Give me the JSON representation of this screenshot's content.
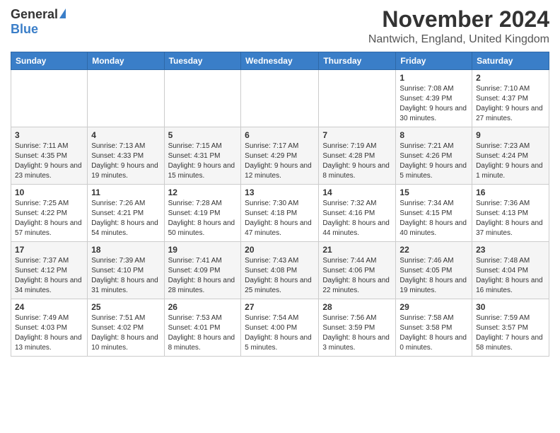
{
  "header": {
    "logo_general": "General",
    "logo_blue": "Blue",
    "month_title": "November 2024",
    "location": "Nantwich, England, United Kingdom"
  },
  "days_of_week": [
    "Sunday",
    "Monday",
    "Tuesday",
    "Wednesday",
    "Thursday",
    "Friday",
    "Saturday"
  ],
  "weeks": [
    [
      {
        "day": "",
        "info": ""
      },
      {
        "day": "",
        "info": ""
      },
      {
        "day": "",
        "info": ""
      },
      {
        "day": "",
        "info": ""
      },
      {
        "day": "",
        "info": ""
      },
      {
        "day": "1",
        "info": "Sunrise: 7:08 AM\nSunset: 4:39 PM\nDaylight: 9 hours and 30 minutes."
      },
      {
        "day": "2",
        "info": "Sunrise: 7:10 AM\nSunset: 4:37 PM\nDaylight: 9 hours and 27 minutes."
      }
    ],
    [
      {
        "day": "3",
        "info": "Sunrise: 7:11 AM\nSunset: 4:35 PM\nDaylight: 9 hours and 23 minutes."
      },
      {
        "day": "4",
        "info": "Sunrise: 7:13 AM\nSunset: 4:33 PM\nDaylight: 9 hours and 19 minutes."
      },
      {
        "day": "5",
        "info": "Sunrise: 7:15 AM\nSunset: 4:31 PM\nDaylight: 9 hours and 15 minutes."
      },
      {
        "day": "6",
        "info": "Sunrise: 7:17 AM\nSunset: 4:29 PM\nDaylight: 9 hours and 12 minutes."
      },
      {
        "day": "7",
        "info": "Sunrise: 7:19 AM\nSunset: 4:28 PM\nDaylight: 9 hours and 8 minutes."
      },
      {
        "day": "8",
        "info": "Sunrise: 7:21 AM\nSunset: 4:26 PM\nDaylight: 9 hours and 5 minutes."
      },
      {
        "day": "9",
        "info": "Sunrise: 7:23 AM\nSunset: 4:24 PM\nDaylight: 9 hours and 1 minute."
      }
    ],
    [
      {
        "day": "10",
        "info": "Sunrise: 7:25 AM\nSunset: 4:22 PM\nDaylight: 8 hours and 57 minutes."
      },
      {
        "day": "11",
        "info": "Sunrise: 7:26 AM\nSunset: 4:21 PM\nDaylight: 8 hours and 54 minutes."
      },
      {
        "day": "12",
        "info": "Sunrise: 7:28 AM\nSunset: 4:19 PM\nDaylight: 8 hours and 50 minutes."
      },
      {
        "day": "13",
        "info": "Sunrise: 7:30 AM\nSunset: 4:18 PM\nDaylight: 8 hours and 47 minutes."
      },
      {
        "day": "14",
        "info": "Sunrise: 7:32 AM\nSunset: 4:16 PM\nDaylight: 8 hours and 44 minutes."
      },
      {
        "day": "15",
        "info": "Sunrise: 7:34 AM\nSunset: 4:15 PM\nDaylight: 8 hours and 40 minutes."
      },
      {
        "day": "16",
        "info": "Sunrise: 7:36 AM\nSunset: 4:13 PM\nDaylight: 8 hours and 37 minutes."
      }
    ],
    [
      {
        "day": "17",
        "info": "Sunrise: 7:37 AM\nSunset: 4:12 PM\nDaylight: 8 hours and 34 minutes."
      },
      {
        "day": "18",
        "info": "Sunrise: 7:39 AM\nSunset: 4:10 PM\nDaylight: 8 hours and 31 minutes."
      },
      {
        "day": "19",
        "info": "Sunrise: 7:41 AM\nSunset: 4:09 PM\nDaylight: 8 hours and 28 minutes."
      },
      {
        "day": "20",
        "info": "Sunrise: 7:43 AM\nSunset: 4:08 PM\nDaylight: 8 hours and 25 minutes."
      },
      {
        "day": "21",
        "info": "Sunrise: 7:44 AM\nSunset: 4:06 PM\nDaylight: 8 hours and 22 minutes."
      },
      {
        "day": "22",
        "info": "Sunrise: 7:46 AM\nSunset: 4:05 PM\nDaylight: 8 hours and 19 minutes."
      },
      {
        "day": "23",
        "info": "Sunrise: 7:48 AM\nSunset: 4:04 PM\nDaylight: 8 hours and 16 minutes."
      }
    ],
    [
      {
        "day": "24",
        "info": "Sunrise: 7:49 AM\nSunset: 4:03 PM\nDaylight: 8 hours and 13 minutes."
      },
      {
        "day": "25",
        "info": "Sunrise: 7:51 AM\nSunset: 4:02 PM\nDaylight: 8 hours and 10 minutes."
      },
      {
        "day": "26",
        "info": "Sunrise: 7:53 AM\nSunset: 4:01 PM\nDaylight: 8 hours and 8 minutes."
      },
      {
        "day": "27",
        "info": "Sunrise: 7:54 AM\nSunset: 4:00 PM\nDaylight: 8 hours and 5 minutes."
      },
      {
        "day": "28",
        "info": "Sunrise: 7:56 AM\nSunset: 3:59 PM\nDaylight: 8 hours and 3 minutes."
      },
      {
        "day": "29",
        "info": "Sunrise: 7:58 AM\nSunset: 3:58 PM\nDaylight: 8 hours and 0 minutes."
      },
      {
        "day": "30",
        "info": "Sunrise: 7:59 AM\nSunset: 3:57 PM\nDaylight: 7 hours and 58 minutes."
      }
    ]
  ]
}
